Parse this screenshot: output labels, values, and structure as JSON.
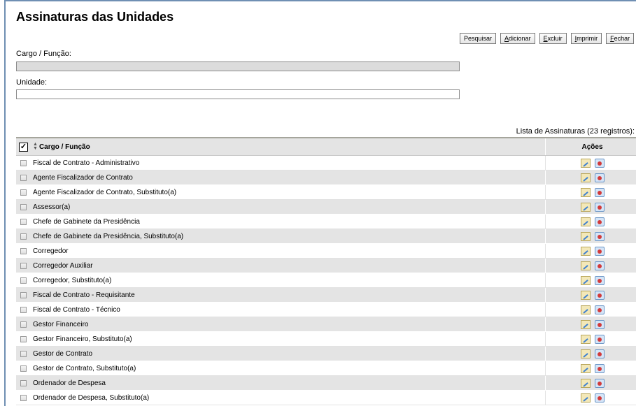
{
  "page": {
    "title": "Assinaturas das Unidades"
  },
  "toolbar": {
    "pesquisar": "Pesquisar",
    "adicionar_u": "A",
    "adicionar_rest": "dicionar",
    "excluir_u": "E",
    "excluir_rest": "xcluir",
    "imprimir_u": "I",
    "imprimir_rest": "mprimir",
    "fechar_u": "F",
    "fechar_rest": "echar"
  },
  "form": {
    "cargo_label": "Cargo / Função:",
    "cargo_value": "",
    "unidade_label": "Unidade:",
    "unidade_value": ""
  },
  "table": {
    "caption": "Lista de Assinaturas (23 registros):",
    "header_name": "Cargo / Função",
    "header_actions": "Ações",
    "rows": [
      "Fiscal de Contrato - Administrativo",
      "Agente Fiscalizador de Contrato",
      "Agente Fiscalizador de Contrato, Substituto(a)",
      "Assessor(a)",
      "Chefe de Gabinete da Presidência",
      "Chefe de Gabinete da Presidência, Substituto(a)",
      "Corregedor",
      "Corregedor Auxiliar",
      "Corregedor, Substituto(a)",
      "Fiscal de Contrato - Requisitante",
      "Fiscal de Contrato - Técnico",
      "Gestor Financeiro",
      "Gestor Financeiro, Substituto(a)",
      "Gestor de Contrato",
      "Gestor de Contrato, Substituto(a)",
      "Ordenador de Despesa",
      "Ordenador de Despesa, Substituto(a)"
    ]
  },
  "icons": {
    "edit": "edit-icon",
    "delete": "delete-icon",
    "sort": "sort-icon"
  }
}
